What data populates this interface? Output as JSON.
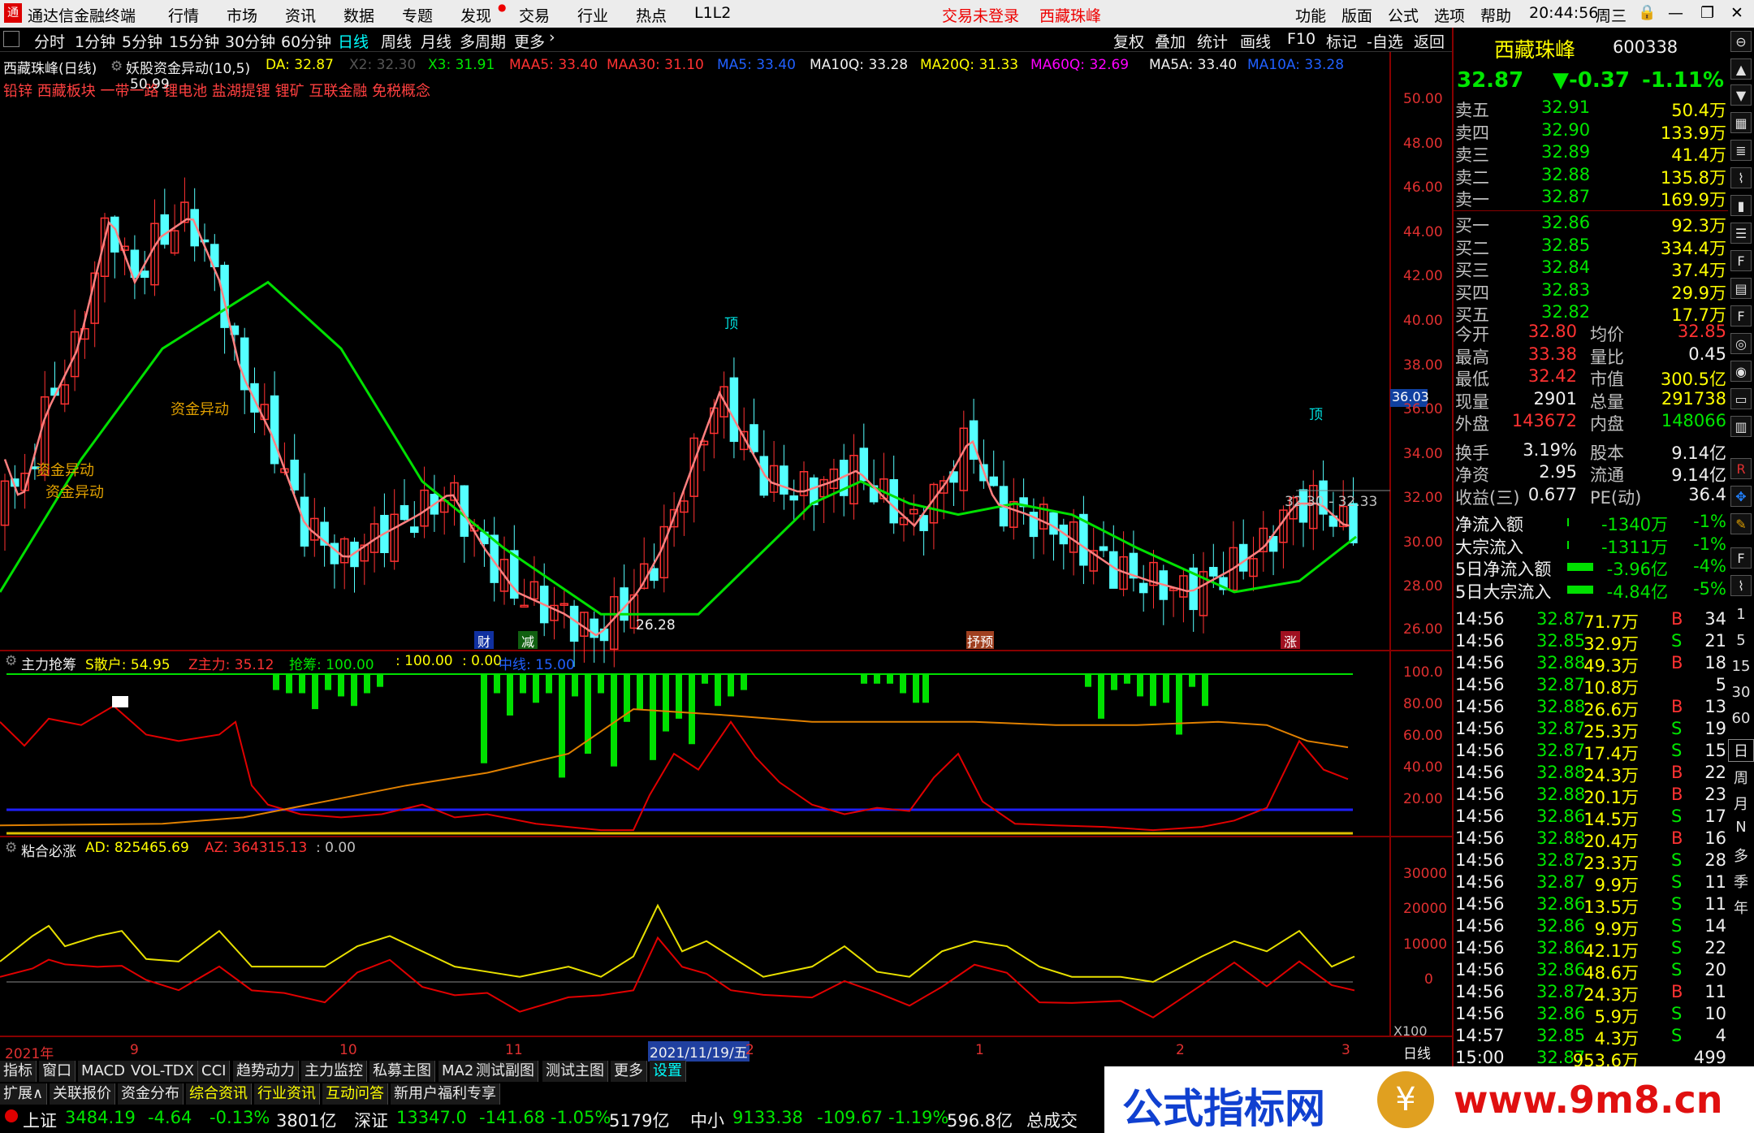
{
  "menubar": {
    "app_title": "通达信金融终端",
    "items": [
      "行情",
      "市场",
      "资讯",
      "数据",
      "专题",
      "发现",
      "交易",
      "行业",
      "热点",
      "L1L2"
    ],
    "login": "交易未登录",
    "stock": "西藏珠峰",
    "right_items": [
      "功能",
      "版面",
      "公式",
      "选项",
      "帮助"
    ],
    "time": "20:44:56",
    "weekday": "周三"
  },
  "periodbar": {
    "items": [
      "分时",
      "1分钟",
      "5分钟",
      "15分钟",
      "30分钟",
      "60分钟",
      "日线",
      "周线",
      "月线",
      "多周期",
      "更多"
    ],
    "active": "日线",
    "right_tools": [
      "复权",
      "叠加",
      "统计",
      "画线",
      "F10",
      "标记",
      "-自选",
      "返回"
    ]
  },
  "chart_header": {
    "name": "西藏珠峰(日线)",
    "indicator": "妖股资金异动(10,5)",
    "DA": "DA: 32.87",
    "X2": "X2: 32.30",
    "X3": "X3: 31.91",
    "MAA5": "MAA5: 33.40",
    "MAA30": "MAA30: 31.10",
    "MA5": "MA5: 33.40",
    "MA10Q": "MA10Q: 33.28",
    "MA20Q": "MA20Q: 31.33",
    "MA60Q": "MA60Q: 32.69",
    "MA5A": "MA5A: 33.40",
    "MA10A": "MA10A: 33.28"
  },
  "concepts": "铅锌 西藏板块 一带一路 锂电池 盐湖提锂 锂矿 互联金融 免税概念",
  "annotations": {
    "high": "50.99",
    "low": "26.28",
    "fund1": "资金异动",
    "fund2": "资金异动",
    "fund3": "资金异动",
    "top1": "顶",
    "top2": "顶",
    "range": "32.30 - 32.33",
    "current": "36.03",
    "tag1": "财",
    "tag2": "减",
    "tag3": "抒预",
    "tag4": "涨"
  },
  "price_axis": [
    "50.00",
    "48.00",
    "46.00",
    "44.00",
    "42.00",
    "40.00",
    "38.00",
    "36.00",
    "34.00",
    "32.00",
    "30.00",
    "28.00",
    "26.00"
  ],
  "panel2": {
    "name": "主力抢筹",
    "S": "S散户: 54.95",
    "Z": "Z主力: 35.12",
    "Q": "抢筹: 100.00",
    "v1": ": 100.00",
    "v2": ": 0.00",
    "mid": "中线: 15.00",
    "axis": [
      "100.0",
      "80.00",
      "60.00",
      "40.00",
      "20.00"
    ]
  },
  "panel3": {
    "name": "粘合必涨",
    "AD": "AD: 825465.69",
    "AZ": "AZ: 364315.13",
    "v": ": 0.00",
    "axis": [
      "30000",
      "20000",
      "10000",
      "0"
    ],
    "unit": "X100"
  },
  "xaxis": {
    "labels": [
      "2021年",
      "9",
      "10",
      "11",
      "2021/11/19/五",
      "2",
      "1",
      "2",
      "3"
    ],
    "right": "日线"
  },
  "quote": {
    "name": "西藏珠峰",
    "code": "600338",
    "price": "32.87",
    "change": "▼-0.37",
    "pct": "-1.11%"
  },
  "asks": [
    {
      "l": "卖五",
      "p": "32.91",
      "v": "50.4万"
    },
    {
      "l": "卖四",
      "p": "32.90",
      "v": "133.9万"
    },
    {
      "l": "卖三",
      "p": "32.89",
      "v": "41.4万"
    },
    {
      "l": "卖二",
      "p": "32.88",
      "v": "135.8万"
    },
    {
      "l": "卖一",
      "p": "32.87",
      "v": "169.9万"
    }
  ],
  "bids": [
    {
      "l": "买一",
      "p": "32.86",
      "v": "92.3万"
    },
    {
      "l": "买二",
      "p": "32.85",
      "v": "334.4万"
    },
    {
      "l": "买三",
      "p": "32.84",
      "v": "37.4万"
    },
    {
      "l": "买四",
      "p": "32.83",
      "v": "29.9万"
    },
    {
      "l": "买五",
      "p": "32.82",
      "v": "17.7万"
    }
  ],
  "stats": [
    [
      "今开",
      "32.80",
      "均价",
      "32.85"
    ],
    [
      "最高",
      "33.38",
      "量比",
      "0.45"
    ],
    [
      "最低",
      "32.42",
      "市值",
      "300.5亿"
    ],
    [
      "现量",
      "2901",
      "总量",
      "291738"
    ],
    [
      "外盘",
      "143672",
      "内盘",
      "148066"
    ],
    [
      "换手",
      "3.19%",
      "股本",
      "9.14亿"
    ],
    [
      "净资",
      "2.95",
      "流通",
      "9.14亿"
    ],
    [
      "收益(三)",
      "0.677",
      "PE(动)",
      "36.4"
    ]
  ],
  "flows": [
    [
      "净流入额",
      "-1340万",
      "-1%"
    ],
    [
      "大宗流入",
      "-1311万",
      "-1%"
    ],
    [
      "5日净流入额",
      "-3.96亿",
      "-4%"
    ],
    [
      "5日大宗流入",
      "-4.84亿",
      "-5%"
    ]
  ],
  "ticks": [
    [
      "14:56",
      "32.87",
      "71.7万",
      "B",
      "34"
    ],
    [
      "14:56",
      "32.85",
      "32.9万",
      "S",
      "21"
    ],
    [
      "14:56",
      "32.88",
      "49.3万",
      "B",
      "18"
    ],
    [
      "14:56",
      "32.87",
      "10.8万",
      "",
      "5"
    ],
    [
      "14:56",
      "32.88",
      "26.6万",
      "B",
      "13"
    ],
    [
      "14:56",
      "32.87",
      "25.3万",
      "S",
      "19"
    ],
    [
      "14:56",
      "32.87",
      "17.4万",
      "S",
      "15"
    ],
    [
      "14:56",
      "32.88",
      "24.3万",
      "B",
      "22"
    ],
    [
      "14:56",
      "32.88",
      "20.1万",
      "B",
      "23"
    ],
    [
      "14:56",
      "32.86",
      "14.5万",
      "S",
      "17"
    ],
    [
      "14:56",
      "32.88",
      "20.4万",
      "B",
      "16"
    ],
    [
      "14:56",
      "32.87",
      "23.3万",
      "S",
      "28"
    ],
    [
      "14:56",
      "32.87",
      "9.9万",
      "S",
      "11"
    ],
    [
      "14:56",
      "32.86",
      "13.5万",
      "S",
      "11"
    ],
    [
      "14:56",
      "32.86",
      "9.9万",
      "S",
      "14"
    ],
    [
      "14:56",
      "32.86",
      "42.1万",
      "S",
      "22"
    ],
    [
      "14:56",
      "32.86",
      "48.6万",
      "S",
      "20"
    ],
    [
      "14:56",
      "32.87",
      "24.3万",
      "B",
      "11"
    ],
    [
      "14:56",
      "32.86",
      "5.9万",
      "S",
      "10"
    ],
    [
      "14:57",
      "32.85",
      "4.3万",
      "S",
      "4"
    ],
    [
      "15:00",
      "32.87",
      "953.6万",
      "",
      "499"
    ]
  ],
  "sidebar_text": [
    "日",
    "周",
    "月",
    "N",
    "多",
    "季",
    "年"
  ],
  "bottom_tabs1": [
    "指标",
    "窗口",
    "MACD",
    "VOL-TDX",
    "CCI",
    "趋势动力",
    "主力监控",
    "私募主图",
    "MA2",
    "测试副图",
    "测试主图",
    "更多",
    "设置"
  ],
  "bottom_tabs2": [
    "扩展∧",
    "关联报价",
    "资金分布",
    "综合资讯",
    "行业资讯",
    "互动问答",
    "新用户福利专享"
  ],
  "status": {
    "sh": "上证",
    "sh_v": "3484.19",
    "sh_c": "-4.64",
    "sh_p": "-0.13%",
    "sh_a": "3801亿",
    "sz": "深证",
    "sz_v": "13347.0",
    "sz_c": "-141.68",
    "sz_p": "-1.05%",
    "sz_a": "5179亿",
    "zx": "中小",
    "zx_v": "9133.38",
    "zx_c": "-109.67",
    "zx_p": "-1.19%",
    "zx_a": "596.8亿",
    "total": "总成交"
  },
  "watermark": {
    "text": "公式指标网",
    "url": "www.9m8.cn"
  }
}
